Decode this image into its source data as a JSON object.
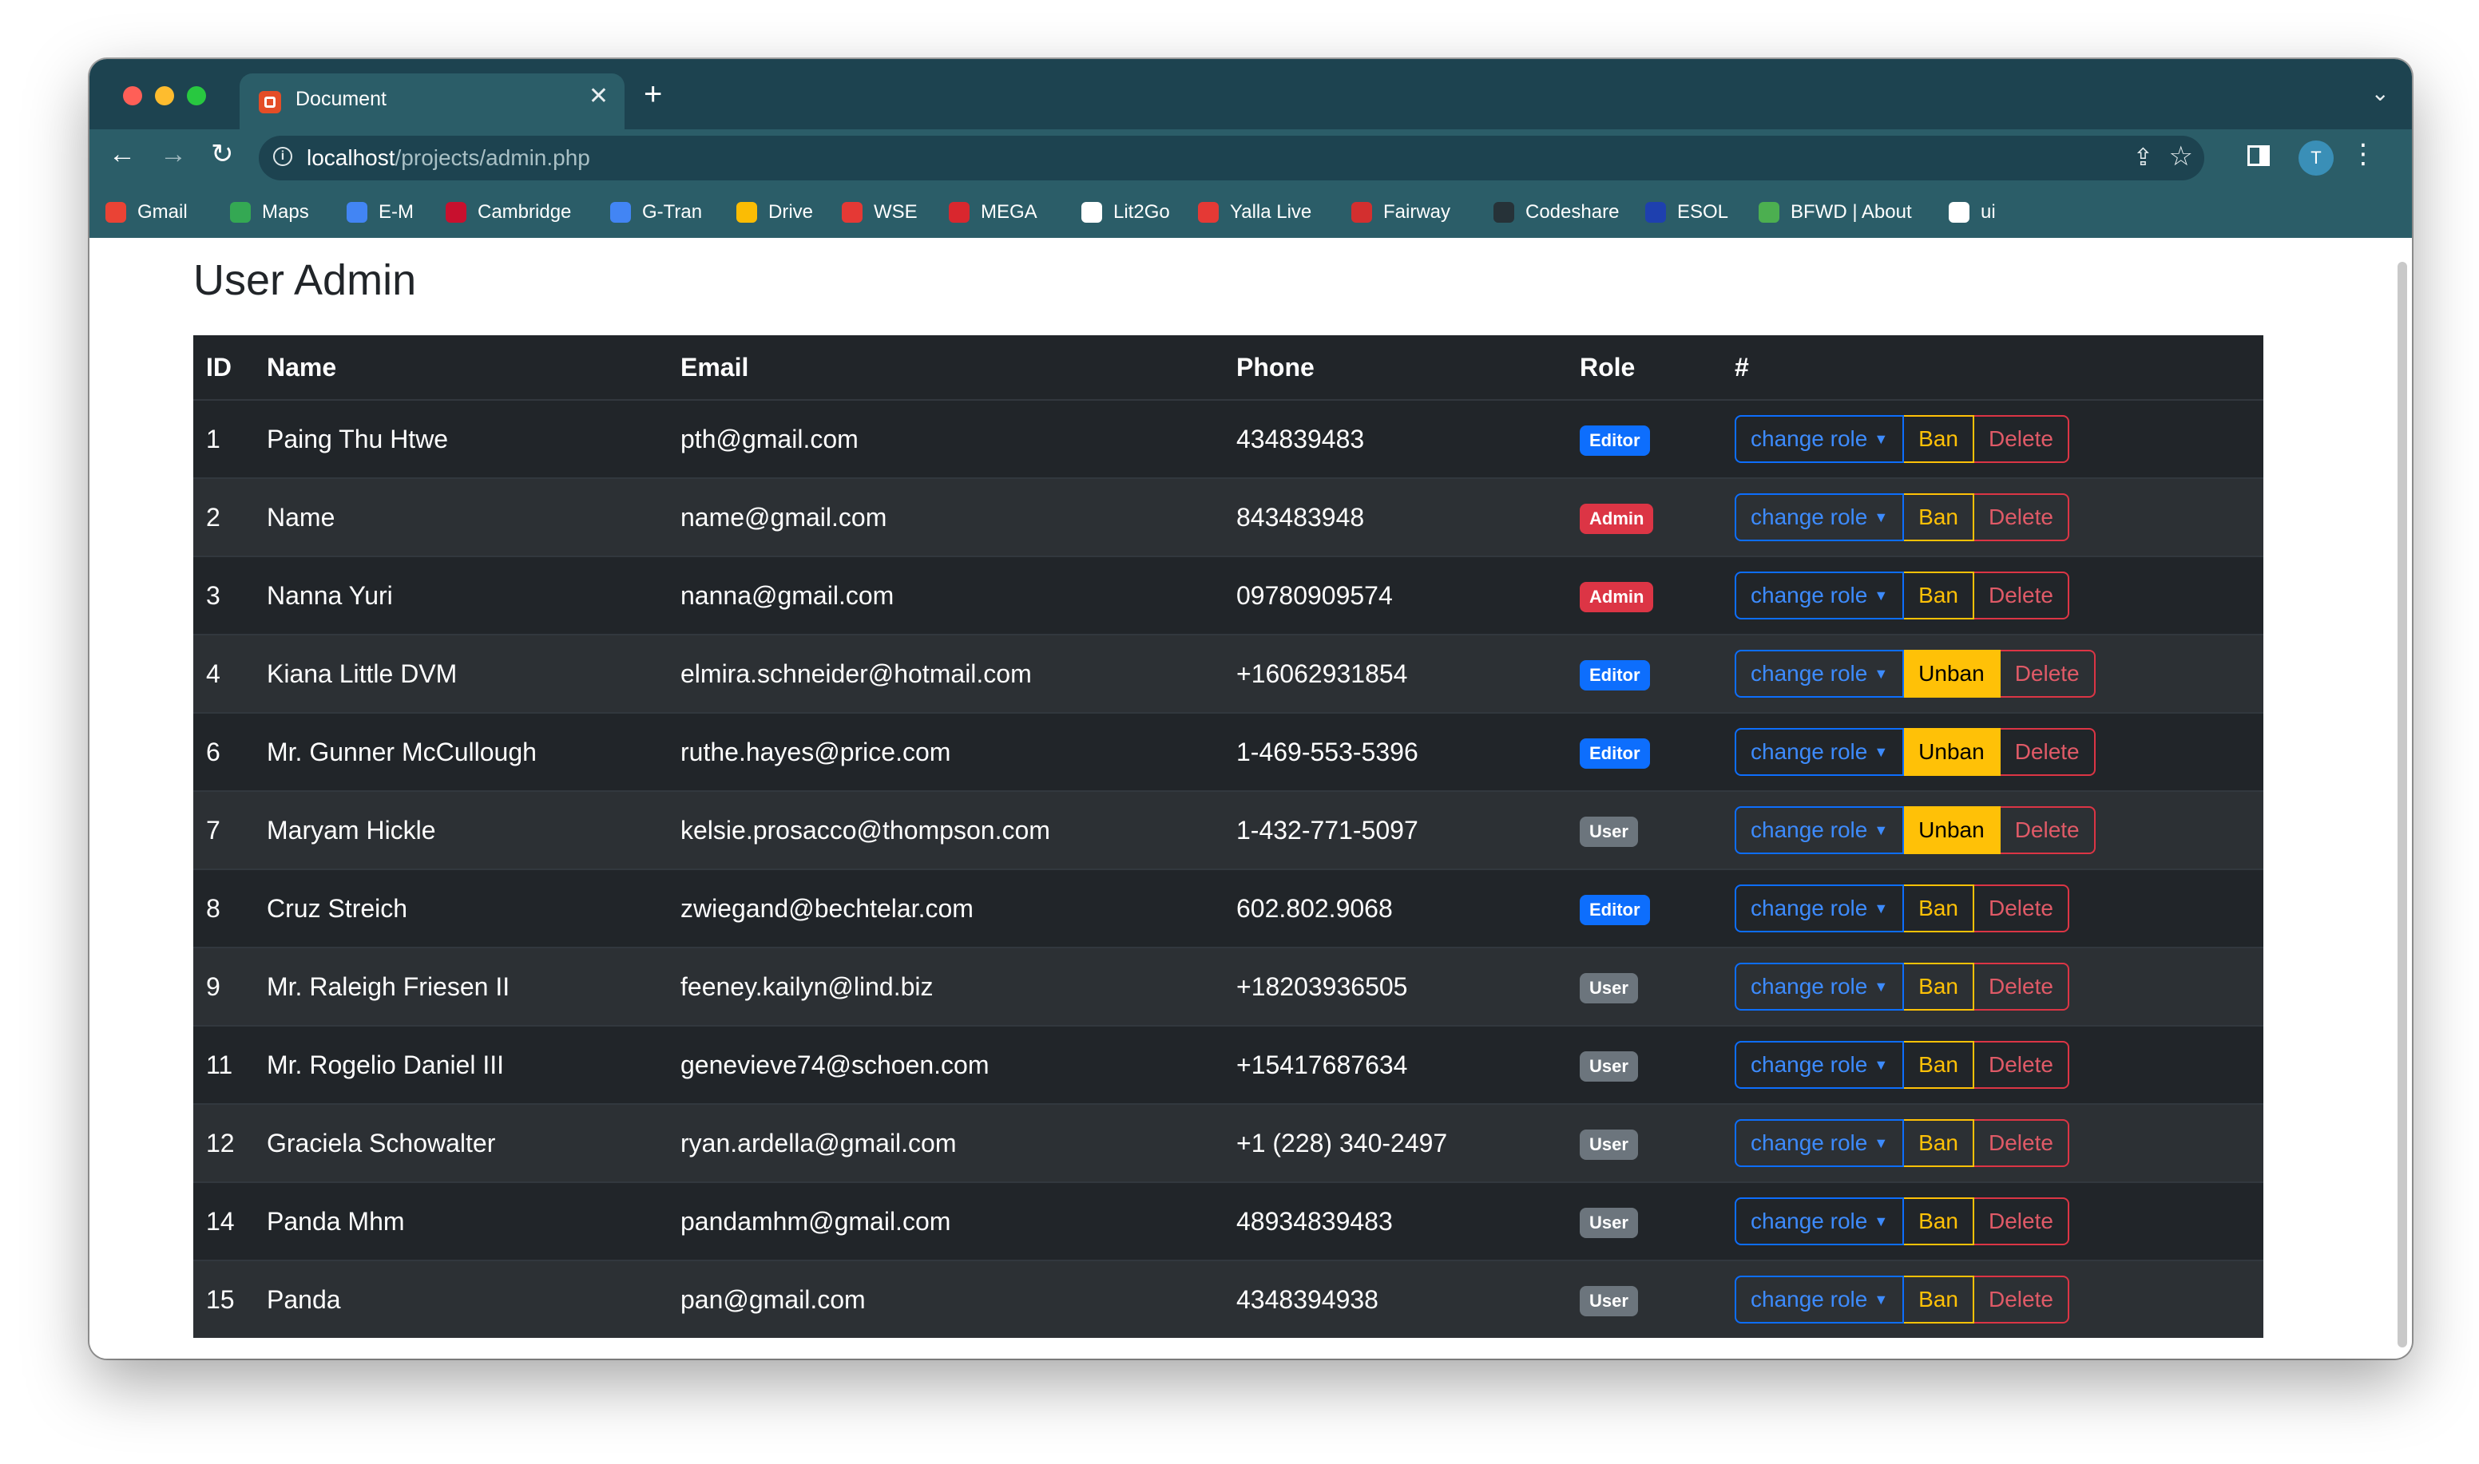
{
  "browser": {
    "tab_title": "Document",
    "url_host": "localhost",
    "url_path": "/projects/admin.php",
    "avatar_letter": "T",
    "bookmarks": [
      {
        "label": "Gmail",
        "color": "#ea4335"
      },
      {
        "label": "Maps",
        "color": "#34a853"
      },
      {
        "label": "E-M",
        "color": "#4285f4"
      },
      {
        "label": "Cambridge",
        "color": "#c8102e"
      },
      {
        "label": "G-Tran",
        "color": "#4285f4"
      },
      {
        "label": "Drive",
        "color": "#fbbc04"
      },
      {
        "label": "WSE",
        "color": "#e53935"
      },
      {
        "label": "MEGA",
        "color": "#d9272e"
      },
      {
        "label": "Lit2Go",
        "color": "#ffffff"
      },
      {
        "label": "Yalla Live",
        "color": "#e53935"
      },
      {
        "label": "Fairway",
        "color": "#d32f2f"
      },
      {
        "label": "Codeshare",
        "color": "#263238"
      },
      {
        "label": "ESOL",
        "color": "#1e40af"
      },
      {
        "label": "BFWD | About",
        "color": "#4caf50"
      },
      {
        "label": "ui",
        "color": "#ffffff"
      }
    ]
  },
  "page": {
    "title": "User Admin",
    "columns": [
      "ID",
      "Name",
      "Email",
      "Phone",
      "Role",
      "#"
    ],
    "actions": {
      "change_role": "change role",
      "ban": "Ban",
      "unban": "Unban",
      "delete": "Delete"
    },
    "rows": [
      {
        "id": "1",
        "name": "Paing Thu Htwe",
        "email": "pth@gmail.com",
        "phone": "434839483",
        "role": "Editor",
        "banned": false
      },
      {
        "id": "2",
        "name": "Name",
        "email": "name@gmail.com",
        "phone": "843483948",
        "role": "Admin",
        "banned": false
      },
      {
        "id": "3",
        "name": "Nanna Yuri",
        "email": "nanna@gmail.com",
        "phone": "09780909574",
        "role": "Admin",
        "banned": false
      },
      {
        "id": "4",
        "name": "Kiana Little DVM",
        "email": "elmira.schneider@hotmail.com",
        "phone": "+16062931854",
        "role": "Editor",
        "banned": true
      },
      {
        "id": "6",
        "name": "Mr. Gunner McCullough",
        "email": "ruthe.hayes@price.com",
        "phone": "1-469-553-5396",
        "role": "Editor",
        "banned": true
      },
      {
        "id": "7",
        "name": "Maryam Hickle",
        "email": "kelsie.prosacco@thompson.com",
        "phone": "1-432-771-5097",
        "role": "User",
        "banned": true
      },
      {
        "id": "8",
        "name": "Cruz Streich",
        "email": "zwiegand@bechtelar.com",
        "phone": "602.802.9068",
        "role": "Editor",
        "banned": false
      },
      {
        "id": "9",
        "name": "Mr. Raleigh Friesen II",
        "email": "feeney.kailyn@lind.biz",
        "phone": "+18203936505",
        "role": "User",
        "banned": false
      },
      {
        "id": "11",
        "name": "Mr. Rogelio Daniel III",
        "email": "genevieve74@schoen.com",
        "phone": "+15417687634",
        "role": "User",
        "banned": false
      },
      {
        "id": "12",
        "name": "Graciela Schowalter",
        "email": "ryan.ardella@gmail.com",
        "phone": "+1 (228) 340-2497",
        "role": "User",
        "banned": false
      },
      {
        "id": "14",
        "name": "Panda Mhm",
        "email": "pandamhm@gmail.com",
        "phone": "48934839483",
        "role": "User",
        "banned": false
      },
      {
        "id": "15",
        "name": "Panda",
        "email": "pan@gmail.com",
        "phone": "4348394938",
        "role": "User",
        "banned": false
      }
    ]
  }
}
